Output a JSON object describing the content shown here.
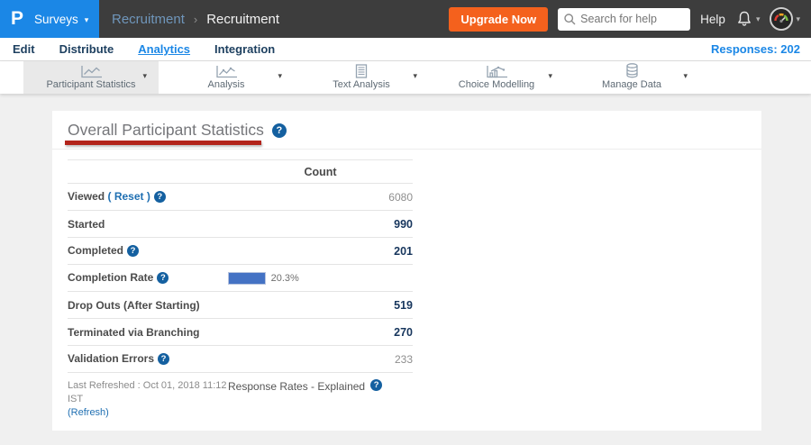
{
  "colors": {
    "accent": "#1b87e6",
    "orange": "#f4611d",
    "bar": "#4472c4",
    "navy": "#17365d",
    "annotation": "#b3241b",
    "dark": "#3d3d3d"
  },
  "header": {
    "logo_letter": "P",
    "app_menu_label": "Surveys",
    "breadcrumb": {
      "parent": "Recruitment",
      "separator": "›",
      "current": "Recruitment"
    },
    "upgrade_label": "Upgrade Now",
    "search_placeholder": "Search for help",
    "help_label": "Help",
    "icons": [
      "search-icon",
      "bell-icon",
      "gauge-avatar-icon",
      "chevron-down-icon"
    ]
  },
  "nav": {
    "items": [
      {
        "label": "Edit",
        "active": false
      },
      {
        "label": "Distribute",
        "active": false
      },
      {
        "label": "Analytics",
        "active": true
      },
      {
        "label": "Integration",
        "active": false
      }
    ],
    "responses_label": "Responses: 202"
  },
  "toolbar": {
    "items": [
      {
        "label": "Participant Statistics",
        "icon": "line-chart",
        "selected": true
      },
      {
        "label": "Analysis",
        "icon": "trend-chart",
        "selected": false
      },
      {
        "label": "Text Analysis",
        "icon": "document",
        "selected": false
      },
      {
        "label": "Choice Modelling",
        "icon": "model-chart",
        "selected": false
      },
      {
        "label": "Manage Data",
        "icon": "database",
        "selected": false
      }
    ]
  },
  "content": {
    "title": "Overall Participant Statistics",
    "table": {
      "count_header": "Count",
      "rows": [
        {
          "label": "Viewed",
          "label_suffix": "( Reset )",
          "has_help": true,
          "value": "6080",
          "value_style": "muted"
        },
        {
          "label": "Started",
          "has_help": false,
          "value": "990",
          "value_style": "strong"
        },
        {
          "label": "Completed",
          "has_help": true,
          "value": "201",
          "value_style": "strong"
        },
        {
          "label": "Completion Rate",
          "has_help": true,
          "bar_percent": 20.3,
          "bar_label": "20.3%"
        },
        {
          "label": "Drop Outs (After Starting)",
          "has_help": false,
          "value": "519",
          "value_style": "strong"
        },
        {
          "label": "Terminated via Branching",
          "has_help": false,
          "value": "270",
          "value_style": "strong"
        },
        {
          "label": "Validation Errors",
          "has_help": true,
          "value": "233",
          "value_style": "muted"
        }
      ],
      "footer": {
        "last_refreshed": "Last Refreshed : Oct 01, 2018 11:12 IST",
        "refresh_link": "(Refresh)",
        "response_rates_label": "Response Rates - Explained"
      }
    }
  }
}
